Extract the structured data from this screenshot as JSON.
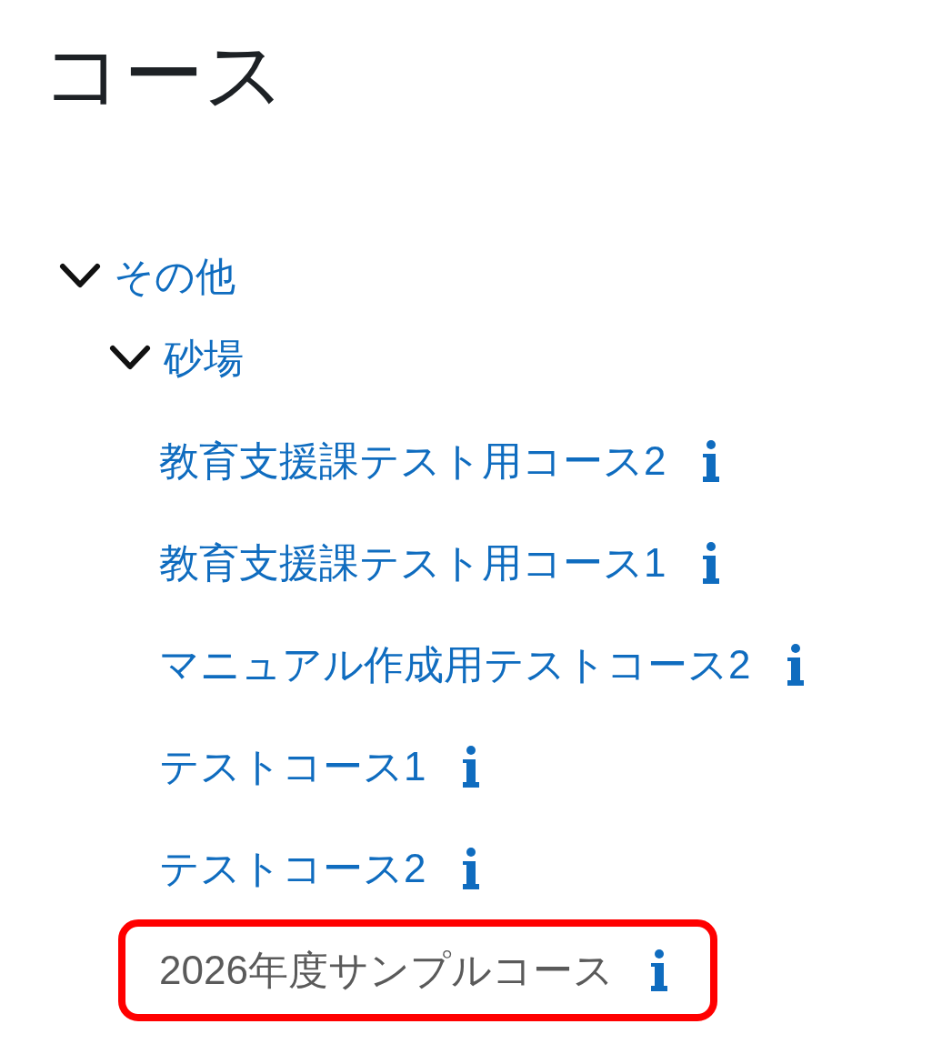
{
  "page": {
    "title": "コース"
  },
  "tree": [
    {
      "kind": "category",
      "label": "その他",
      "expanded": true,
      "children": [
        {
          "kind": "category",
          "label": "砂場",
          "expanded": true,
          "children": [
            {
              "kind": "course",
              "label": "教育支援課テスト用コース2",
              "dimmed": false,
              "highlighted": false
            },
            {
              "kind": "course",
              "label": "教育支援課テスト用コース1",
              "dimmed": false,
              "highlighted": false
            },
            {
              "kind": "course",
              "label": "マニュアル作成用テストコース2",
              "dimmed": false,
              "highlighted": false
            },
            {
              "kind": "course",
              "label": "テストコース1",
              "dimmed": false,
              "highlighted": false
            },
            {
              "kind": "course",
              "label": "テストコース2",
              "dimmed": false,
              "highlighted": false
            },
            {
              "kind": "course",
              "label": "2026年度サンプルコース",
              "dimmed": true,
              "highlighted": true
            }
          ]
        }
      ]
    }
  ]
}
